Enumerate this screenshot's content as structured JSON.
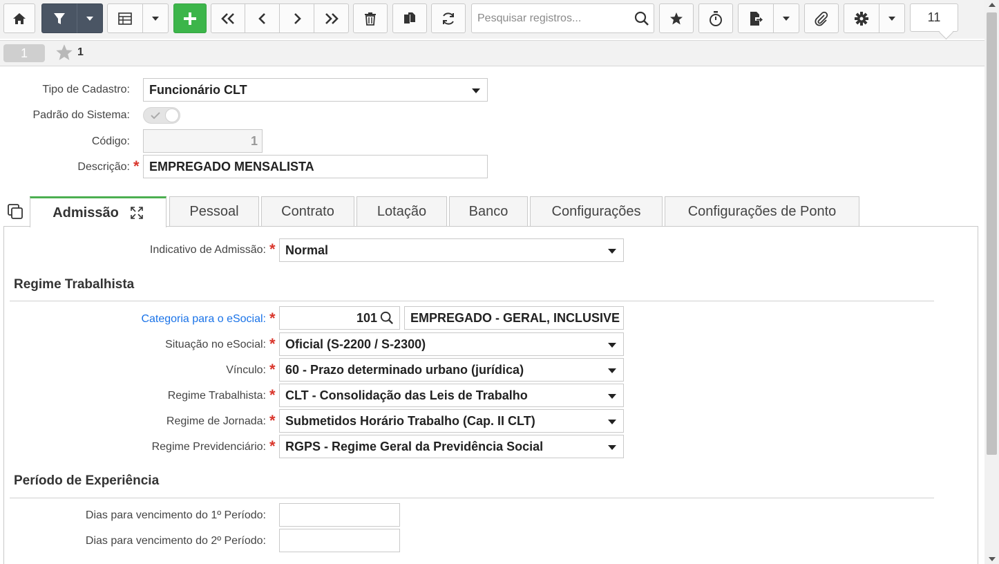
{
  "toolbar": {
    "search_placeholder": "Pesquisar registros...",
    "record_count": "11",
    "icons": [
      "home-icon",
      "filter-icon",
      "grid-icon",
      "plus-icon",
      "first-icon",
      "prev-icon",
      "next-icon",
      "last-icon",
      "trash-icon",
      "copy-icon",
      "refresh-icon",
      "search-icon",
      "star-icon",
      "timer-icon",
      "export-icon",
      "paperclip-icon",
      "gear-icon"
    ],
    "colors": {
      "dark_button": "#4a5564",
      "add_button": "#3cb54a"
    }
  },
  "record_bar": {
    "record_tab": "1",
    "favorite_count": "1"
  },
  "form": {
    "tipo_cadastro": {
      "label": "Tipo de Cadastro:",
      "value": "Funcionário CLT"
    },
    "padrao_sistema": {
      "label": "Padrão do Sistema:"
    },
    "codigo": {
      "label": "Código:",
      "value": "1"
    },
    "descricao": {
      "label": "Descrição:",
      "value": "EMPREGADO MENSALISTA"
    }
  },
  "tabs": [
    {
      "label": "Admissão"
    },
    {
      "label": "Pessoal"
    },
    {
      "label": "Contrato"
    },
    {
      "label": "Lotação"
    },
    {
      "label": "Banco"
    },
    {
      "label": "Configurações"
    },
    {
      "label": "Configurações de Ponto"
    }
  ],
  "admissao": {
    "indicativo": {
      "label": "Indicativo de Admissão:",
      "value": "Normal"
    },
    "regime_section": "Regime Trabalhista",
    "categoria": {
      "label": "Categoria para o eSocial:",
      "code": "101",
      "description": "EMPREGADO - GERAL, INCLUSIVE"
    },
    "situacao": {
      "label": "Situação no eSocial:",
      "value": "Oficial (S-2200 / S-2300)"
    },
    "vinculo": {
      "label": "Vínculo:",
      "value": "60 - Prazo determinado urbano (jurídica)"
    },
    "regime_trabalhista": {
      "label": "Regime Trabalhista:",
      "value": "CLT - Consolidação das Leis de Trabalho"
    },
    "regime_jornada": {
      "label": "Regime de Jornada:",
      "value": "Submetidos Horário Trabalho (Cap. II CLT)"
    },
    "regime_previdenciario": {
      "label": "Regime Previdenciário:",
      "value": "RGPS - Regime Geral da Previdência Social"
    },
    "experiencia_section": "Período de Experiência",
    "dias_1": {
      "label": "Dias para vencimento do 1º Período:",
      "value": ""
    },
    "dias_2": {
      "label": "Dias para vencimento do 2º Período:",
      "value": ""
    }
  }
}
